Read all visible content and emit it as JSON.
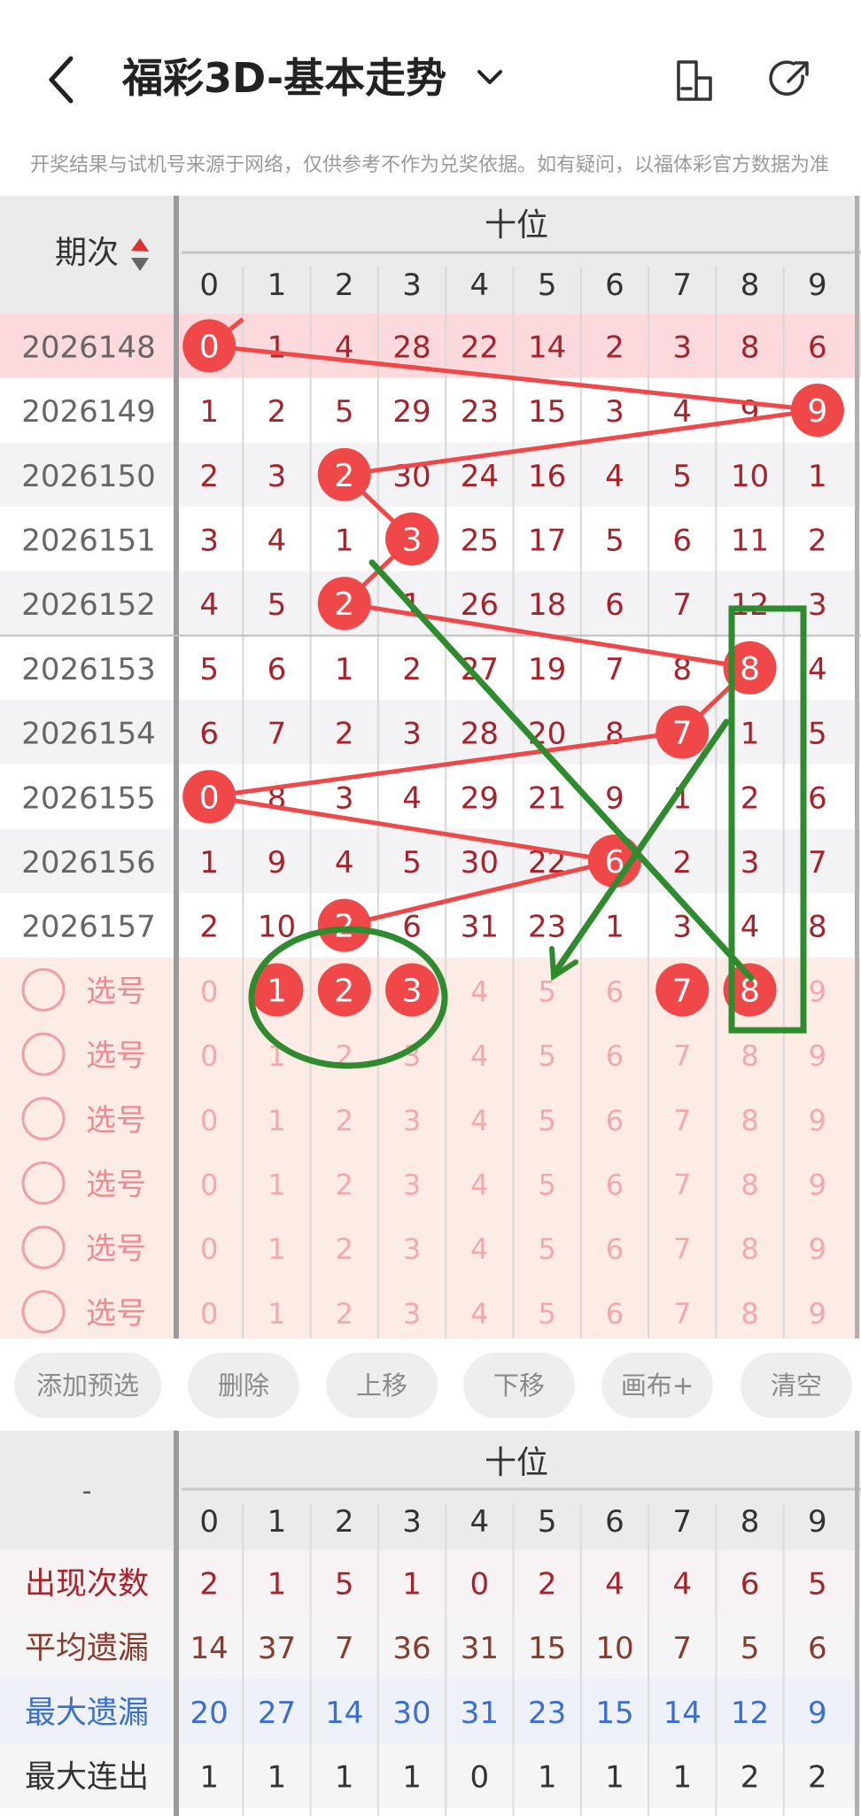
{
  "header": {
    "title": "福彩3D-基本走势"
  },
  "disclaimer": "开奖结果与试机号来源于网络，仅供参考不作为兑奖依据。如有疑问，以福体彩官方数据为准",
  "colors": {
    "red_ball": "#f04848",
    "highlight_row": "#fbd9dc",
    "select_bg": "#fdebe6",
    "stripe": "#f3f3f5",
    "header_bg": "#ebebeb",
    "green_annot": "#2e8b2e",
    "blue_text": "#3a6fd0",
    "dark_red_text": "#a8222a"
  },
  "grid": {
    "section_title": "十位",
    "period_label": "期次",
    "digits": [
      "0",
      "1",
      "2",
      "3",
      "4",
      "5",
      "6",
      "7",
      "8",
      "9"
    ],
    "rows": [
      {
        "period": "2026148",
        "values": [
          "0",
          "1",
          "4",
          "28",
          "22",
          "14",
          "2",
          "3",
          "8",
          "6"
        ],
        "hit": 0,
        "highlight": true
      },
      {
        "period": "2026149",
        "values": [
          "1",
          "2",
          "5",
          "29",
          "23",
          "15",
          "3",
          "4",
          "9",
          "9"
        ],
        "hit": 9,
        "highlight": false
      },
      {
        "period": "2026150",
        "values": [
          "2",
          "3",
          "2",
          "30",
          "24",
          "16",
          "4",
          "5",
          "10",
          "1"
        ],
        "hit": 2,
        "highlight": false
      },
      {
        "period": "2026151",
        "values": [
          "3",
          "4",
          "1",
          "3",
          "25",
          "17",
          "5",
          "6",
          "11",
          "2"
        ],
        "hit": 3,
        "highlight": false
      },
      {
        "period": "2026152",
        "values": [
          "4",
          "5",
          "2",
          "1",
          "26",
          "18",
          "6",
          "7",
          "12",
          "3"
        ],
        "hit": 2,
        "highlight": false
      },
      {
        "period": "2026153",
        "values": [
          "5",
          "6",
          "1",
          "2",
          "27",
          "19",
          "7",
          "8",
          "8",
          "4"
        ],
        "hit": 8,
        "highlight": false
      },
      {
        "period": "2026154",
        "values": [
          "6",
          "7",
          "2",
          "3",
          "28",
          "20",
          "8",
          "7",
          "1",
          "5"
        ],
        "hit": 7,
        "highlight": false
      },
      {
        "period": "2026155",
        "values": [
          "0",
          "8",
          "3",
          "4",
          "29",
          "21",
          "9",
          "1",
          "2",
          "6"
        ],
        "hit": 0,
        "highlight": false
      },
      {
        "period": "2026156",
        "values": [
          "1",
          "9",
          "4",
          "5",
          "30",
          "22",
          "6",
          "2",
          "3",
          "7"
        ],
        "hit": 6,
        "highlight": false
      },
      {
        "period": "2026157",
        "values": [
          "2",
          "10",
          "2",
          "6",
          "31",
          "23",
          "1",
          "3",
          "4",
          "8"
        ],
        "hit": 2,
        "highlight": false
      }
    ],
    "select_label": "选号",
    "select_rows": [
      {
        "selected": [
          1,
          2,
          3,
          7,
          8
        ]
      },
      {
        "selected": []
      },
      {
        "selected": []
      },
      {
        "selected": []
      },
      {
        "selected": []
      },
      {
        "selected": []
      }
    ]
  },
  "toolbar": {
    "buttons": [
      "添加预选",
      "删除",
      "上移",
      "下移",
      "画布+",
      "清空"
    ]
  },
  "stats": {
    "section_title": "十位",
    "corner_label": "-",
    "digits": [
      "0",
      "1",
      "2",
      "3",
      "4",
      "5",
      "6",
      "7",
      "8",
      "9"
    ],
    "rows": [
      {
        "label": "出现次数",
        "values": [
          "2",
          "1",
          "5",
          "1",
          "0",
          "2",
          "4",
          "4",
          "6",
          "5"
        ],
        "color": "#a8222a"
      },
      {
        "label": "平均遗漏",
        "values": [
          "14",
          "37",
          "7",
          "36",
          "31",
          "15",
          "10",
          "7",
          "5",
          "6"
        ],
        "color": "#8a3a2a"
      },
      {
        "label": "最大遗漏",
        "values": [
          "20",
          "27",
          "14",
          "30",
          "31",
          "23",
          "15",
          "14",
          "12",
          "9"
        ],
        "color": "#3a6fd0"
      },
      {
        "label": "最大连出",
        "values": [
          "1",
          "1",
          "1",
          "1",
          "0",
          "1",
          "1",
          "1",
          "2",
          "2"
        ],
        "color": "#333333"
      }
    ]
  }
}
